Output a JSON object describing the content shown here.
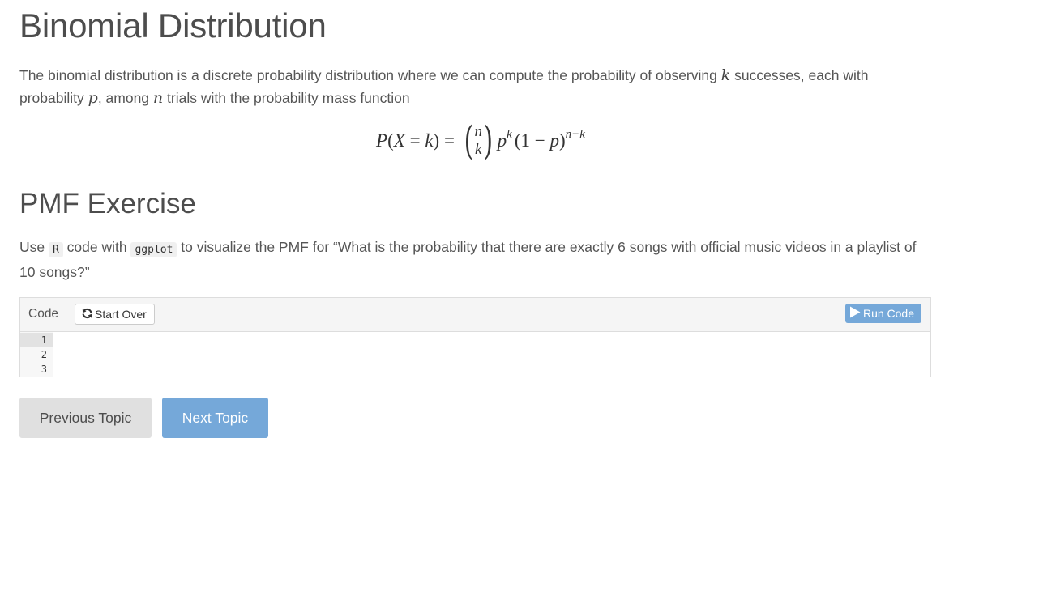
{
  "page": {
    "title": "Binomial Distribution",
    "intro": {
      "part1": "The binomial distribution is a discrete probability distribution where we can compute the probability of observing ",
      "var_k": "k",
      "part2": " successes, each with probability ",
      "var_p": "p",
      "part3": ", among ",
      "var_n": "n",
      "part4": " trials with the probability mass function"
    },
    "formula": {
      "lhs_P": "P",
      "lhs_open": "(",
      "lhs_X": "X",
      "lhs_eq": " = ",
      "lhs_k": "k",
      "lhs_close": ")",
      "equals": " = ",
      "binom_top": "n",
      "binom_bottom": "k",
      "p1": "p",
      "p1_exp": "k",
      "mid": "(1 − ",
      "p2": "p",
      "close": ")",
      "exp2": "n−k"
    }
  },
  "exercise": {
    "heading": "PMF Exercise",
    "instructions": {
      "part1": "Use ",
      "code1": "R",
      "part2": " code with ",
      "code2": "ggplot",
      "part3": " to visualize the PMF for “What is the probability that there are exactly 6 songs with official music videos in a playlist of 10 songs?”"
    },
    "code_panel": {
      "label": "Code",
      "start_over_label": "Start Over",
      "start_over_icon": "refresh-icon",
      "run_code_label": "Run Code",
      "run_code_icon": "play-icon",
      "line_numbers": [
        "1",
        "2",
        "3"
      ],
      "active_line": 1,
      "code": ""
    }
  },
  "navigation": {
    "previous_label": "Previous Topic",
    "next_label": "Next Topic"
  },
  "colors": {
    "accent": "#75a8d9",
    "text": "#555555",
    "heading": "#4d4d4d",
    "secondary_button": "#e0e0e0"
  }
}
